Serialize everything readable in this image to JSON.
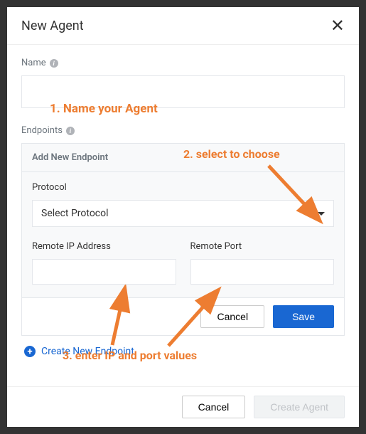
{
  "modal": {
    "title": "New Agent"
  },
  "name": {
    "label": "Name",
    "value": ""
  },
  "endpoints": {
    "label": "Endpoints",
    "card_title": "Add New Endpoint",
    "protocol": {
      "label": "Protocol",
      "selected": "Select Protocol"
    },
    "remote_ip": {
      "label": "Remote IP Address",
      "value": ""
    },
    "remote_port": {
      "label": "Remote Port",
      "value": ""
    },
    "cancel": "Cancel",
    "save": "Save",
    "create_link": "Create New Endpoint"
  },
  "footer": {
    "cancel": "Cancel",
    "create": "Create Agent"
  },
  "annotations": {
    "a1": "1. Name your Agent",
    "a2": "2. select to choose",
    "a3": "3. enter IP and port values"
  }
}
